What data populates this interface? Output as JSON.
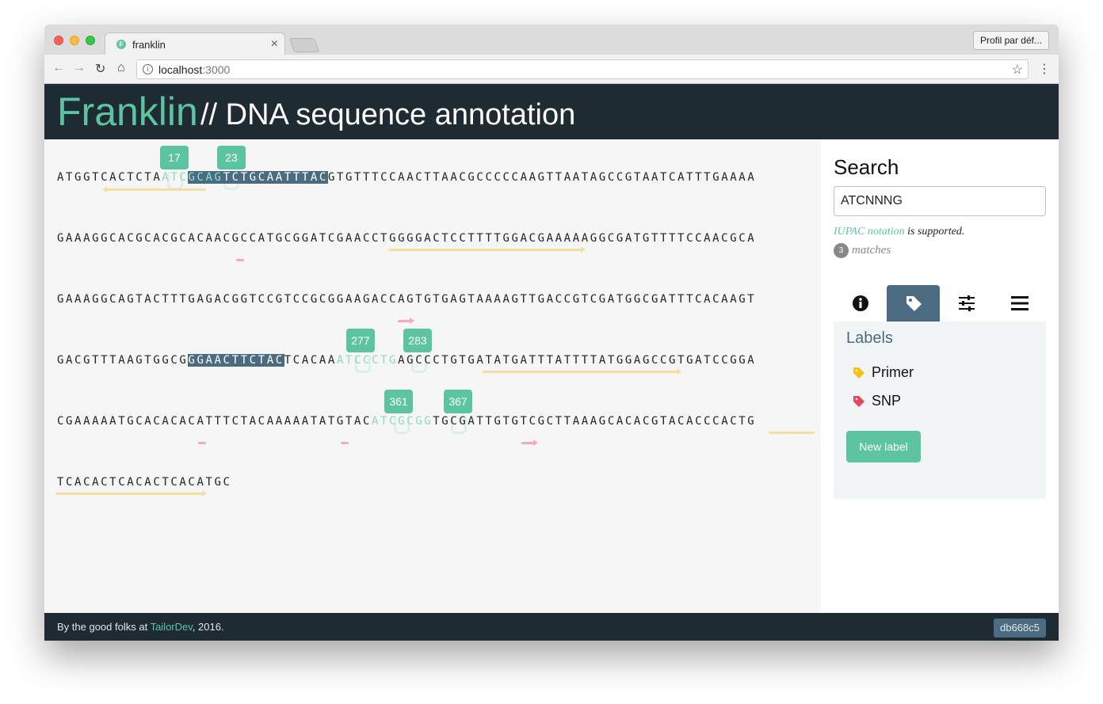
{
  "browser": {
    "tab_title": "franklin",
    "url_host": "localhost",
    "url_port": ":3000",
    "profile_label": "Profil par déf..."
  },
  "header": {
    "title": "Franklin",
    "subtitle": "// DNA sequence annotation"
  },
  "sequence": {
    "line1": {
      "a": "ATGGTCACTCTA",
      "b": "ATC",
      "c": "GCAG",
      "d": "TCTGCAATTTAC",
      "e": "GTGTTTCCAACTTAACGCCCCCAAGTTAATAGCCGTAATCATTTGAAAA"
    },
    "line2": "GAAAGGCACGCACGCACAACGCCATGCGGATCGAACCTGGGGACTCCTTTTGGACGAAAAAGGCGATGTTTTCCAACGCA",
    "line3": "GAAAGGCAGTACTTTGAGACGGTCCGTCCGCGGAAGACCAGTGTGAGTAAAAGTTGACCGTCGATGGCGATTTCACAAGT",
    "line4": {
      "a": "GACGTTTAAGTGGCG",
      "b": "GGAACTTCTAC",
      "c": "TCACAA",
      "d": "ATCCCTG",
      "e": "AGCCCTGTGATATGATTTATTTTATGGAGCCGTGATCCGGA"
    },
    "line5": {
      "a": "CGAAAAATGCACACACATTTCTACAAAAATATGTAC",
      "b": "ATCGCGG",
      "c": "TGCGATTGTGTCGCTTAAAGCACACGTACACCCACTG"
    },
    "line6": "TCACACTCACACTCACATGC"
  },
  "match_badges": [
    "17",
    "23",
    "277",
    "283",
    "361",
    "367"
  ],
  "search": {
    "heading": "Search",
    "value": "ATCNNNG",
    "iupac_link": "IUPAC notation",
    "iupac_rest": " is supported.",
    "match_count": "3",
    "matches_label": "matches"
  },
  "sidebar_tabs": [
    {
      "name": "info-icon",
      "active": false
    },
    {
      "name": "tag-icon",
      "active": true
    },
    {
      "name": "sliders-icon",
      "active": false
    },
    {
      "name": "list-icon",
      "active": false
    }
  ],
  "labels_panel": {
    "heading": "Labels",
    "items": [
      {
        "name": "Primer",
        "color": "#f5c211"
      },
      {
        "name": "SNP",
        "color": "#e8445a"
      }
    ],
    "new_label_button": "New label"
  },
  "footer": {
    "text_prefix": "By the good folks at ",
    "link": "TailorDev",
    "text_suffix": ", 2016.",
    "version": "db668c5"
  },
  "colors": {
    "accent": "#5cc4a0",
    "header_bg": "#1f2b33",
    "highlight": "#4a6b80",
    "primer_track": "#f5dfa0",
    "snp_track": "#f4aab8"
  }
}
